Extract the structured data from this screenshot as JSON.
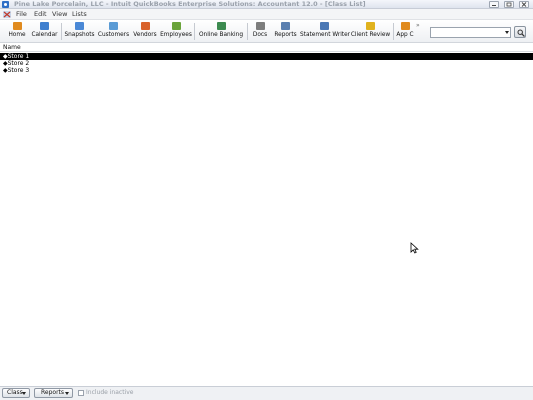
{
  "window": {
    "title": "Pine Lake Porcelain, LLC - Intuit QuickBooks Enterprise Solutions: Accountant 12.0 - [Class List]",
    "controls": [
      "minimize",
      "restore",
      "close"
    ]
  },
  "menu": {
    "items": [
      "File",
      "Edit",
      "View",
      "Lists"
    ]
  },
  "toolbar": {
    "buttons": [
      {
        "label": "Home",
        "icon": "home-icon",
        "color": "#e08a1e"
      },
      {
        "label": "Calendar",
        "icon": "calendar-icon",
        "color": "#3f7fcf"
      },
      {
        "label": "Snapshots",
        "icon": "snapshots-icon",
        "color": "#4a88d6"
      },
      {
        "label": "Customers",
        "icon": "customers-icon",
        "color": "#5b9bd5"
      },
      {
        "label": "Vendors",
        "icon": "vendors-icon",
        "color": "#d9622b"
      },
      {
        "label": "Employees",
        "icon": "employees-icon",
        "color": "#6aa33a"
      },
      {
        "label": "Online Banking",
        "icon": "online-banking-icon",
        "color": "#3c8a4f"
      },
      {
        "label": "Docs",
        "icon": "docs-icon",
        "color": "#7d7d7d"
      },
      {
        "label": "Reports",
        "icon": "reports-icon",
        "color": "#5a7fb0"
      },
      {
        "label": "Statement Writer",
        "icon": "statement-writer-icon",
        "color": "#4b78b5"
      },
      {
        "label": "Client Review",
        "icon": "client-review-icon",
        "color": "#e0b21e"
      },
      {
        "label": "App C",
        "icon": "app-center-icon",
        "color": "#e08a1e"
      }
    ],
    "overflow": "»",
    "search_value": ""
  },
  "list": {
    "column_header": "Name",
    "rows": [
      {
        "name": "◆Store 1",
        "selected": true
      },
      {
        "name": "◆Store 2",
        "selected": false
      },
      {
        "name": "◆Store 3",
        "selected": false
      }
    ]
  },
  "bottom": {
    "class_button": "Class",
    "reports_button": "Reports",
    "include_inactive": "Include inactive",
    "include_inactive_checked": false
  }
}
